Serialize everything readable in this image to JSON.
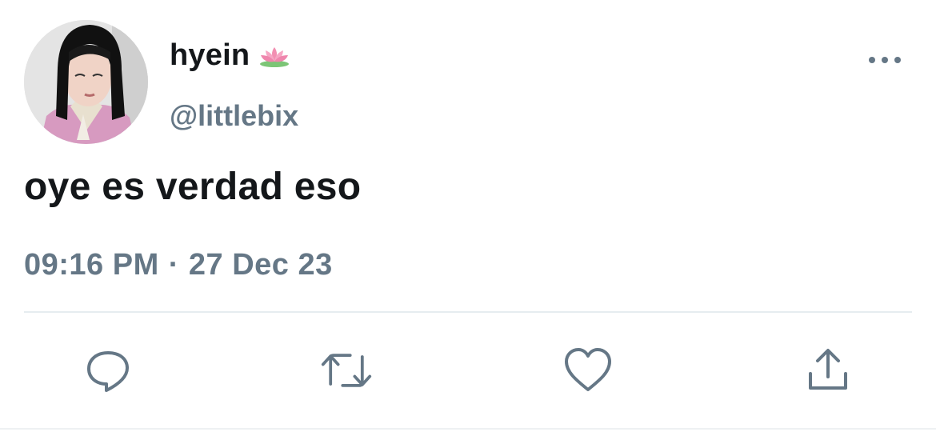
{
  "user": {
    "display_name": "hyein",
    "handle": "@littlebix"
  },
  "tweet": {
    "text": "oye es verdad eso",
    "time": "09:16 PM",
    "separator": "·",
    "date": "27 Dec 23"
  },
  "icons": {
    "name_emoji": "lotus-icon",
    "more": "more-options-icon",
    "reply": "reply-icon",
    "retweet": "retweet-icon",
    "like": "heart-icon",
    "share": "share-icon"
  },
  "colors": {
    "text": "#14171a",
    "secondary": "#657786",
    "divider": "#e6ecf0"
  }
}
